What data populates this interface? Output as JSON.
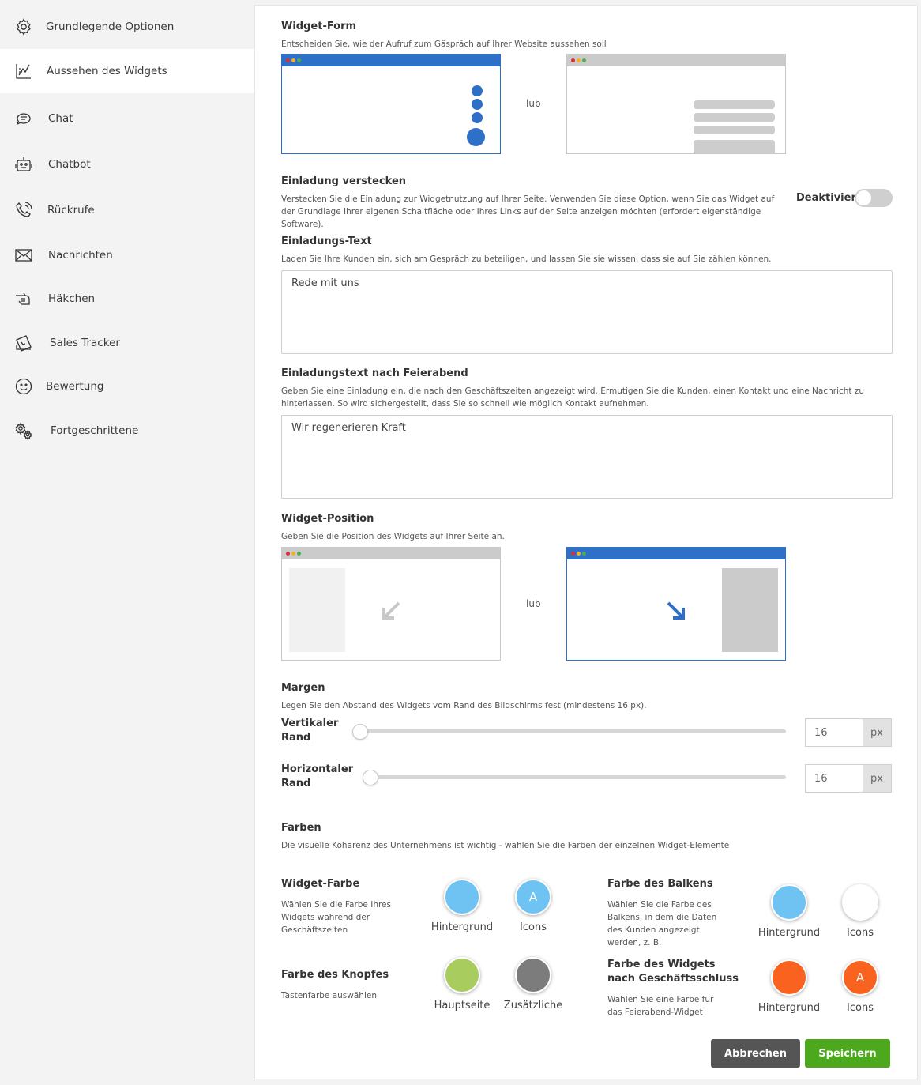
{
  "sidebar": {
    "items": [
      {
        "label": "Grundlegende Optionen",
        "icon": "gear-icon"
      },
      {
        "label": "Aussehen des Widgets",
        "icon": "brush-icon"
      },
      {
        "label": "Chat",
        "icon": "chat-icon"
      },
      {
        "label": "Chatbot",
        "icon": "robot-icon"
      },
      {
        "label": "Rückrufe",
        "icon": "phone-icon"
      },
      {
        "label": "Nachrichten",
        "icon": "envelope-icon"
      },
      {
        "label": "Häkchen",
        "icon": "pointing-hand-icon"
      },
      {
        "label": "Sales Tracker",
        "icon": "money-ticket-icon"
      },
      {
        "label": "Bewertung",
        "icon": "smiley-icon"
      },
      {
        "label": "Fortgeschrittene",
        "icon": "gears-icon"
      }
    ],
    "active_index": 1
  },
  "widget_form": {
    "title": "Widget-Form",
    "desc": "Entscheiden Sie, wie der Aufruf zum Gäspräch auf Ihrer Website aussehen soll",
    "or": "lub"
  },
  "hide_invitation": {
    "title": "Einladung verstecken",
    "desc": "Verstecken Sie die Einladung zur Widgetnutzung auf Ihrer Seite. Verwenden Sie diese Option, wenn Sie das Widget auf der Grundlage Ihrer eigenen Schaltfläche oder Ihres Links auf der Seite anzeigen möchten (erfordert eigenständige Software).",
    "toggle_label": "Deaktiviert"
  },
  "invitation_text": {
    "title": "Einladungs-Text",
    "desc": "Laden Sie Ihre Kunden ein, sich am Gespräch zu beteiligen, und lassen Sie sie wissen, dass sie auf Sie zählen können.",
    "value": "Rede mit uns"
  },
  "after_hours_text": {
    "title": "Einladungstext nach Feierabend",
    "desc": "Geben Sie eine Einladung ein, die nach den Geschäftszeiten angezeigt wird. Ermutigen Sie die Kunden, einen Kontakt und eine Nachricht zu hinterlassen. So wird sichergestellt, dass Sie so schnell wie möglich Kontakt aufnehmen.",
    "value": "Wir regenerieren Kraft"
  },
  "widget_position": {
    "title": "Widget-Position",
    "desc": "Geben Sie die Position des Widgets auf Ihrer Seite an.",
    "or": "lub"
  },
  "margins": {
    "title": "Margen",
    "desc": "Legen Sie den Abstand des Widgets vom Rand des Bildschirms fest (mindestens 16 px).",
    "vertical": {
      "label_1": "Vertikaler",
      "label_2": "Rand",
      "value": "16",
      "unit": "px"
    },
    "horizontal": {
      "label_1": "Horizontaler",
      "label_2": "Rand",
      "value": "16",
      "unit": "px"
    }
  },
  "colors": {
    "title": "Farben",
    "desc": "Die visuelle Kohärenz des Unternehmens ist wichtig - wählen Sie die Farben der einzelnen Widget-Elemente",
    "widget_color": {
      "title": "Widget-Farbe",
      "desc": "Wählen Sie die Farbe Ihres Widgets während der Geschäftszeiten",
      "bg_label": "Hintergrund",
      "bg_color": "#6ec3f2",
      "icons_label": "Icons",
      "icons_color": "#6ec3f2",
      "icons_glyph": "A"
    },
    "bar_color": {
      "title": "Farbe des Balkens",
      "desc": "Wählen Sie die Farbe des Balkens, in dem die Daten des Kunden angezeigt werden, z. B.",
      "bg_label": "Hintergrund",
      "bg_color": "#6ec3f2",
      "icons_label": "Icons",
      "icons_color": "#ffffff"
    },
    "button_color": {
      "title": "Farbe des Knopfes",
      "desc": "Tastenfarbe auswählen",
      "main_label": "Hauptseite",
      "main_color": "#a9cc5e",
      "extra_label": "Zusätzliche",
      "extra_color": "#7c7c7c"
    },
    "after_hours_color": {
      "title_1": "Farbe des Widgets",
      "title_2": "nach Geschäftsschluss",
      "desc": "Wählen Sie eine Farbe für das Feierabend-Widget",
      "bg_label": "Hintergrund",
      "bg_color": "#f9621f",
      "icons_label": "Icons",
      "icons_color": "#f9621f",
      "icons_glyph": "A"
    }
  },
  "actions": {
    "cancel": "Abbrechen",
    "cancel_color": "#555555",
    "save": "Speichern",
    "save_color": "#4ca81c"
  }
}
